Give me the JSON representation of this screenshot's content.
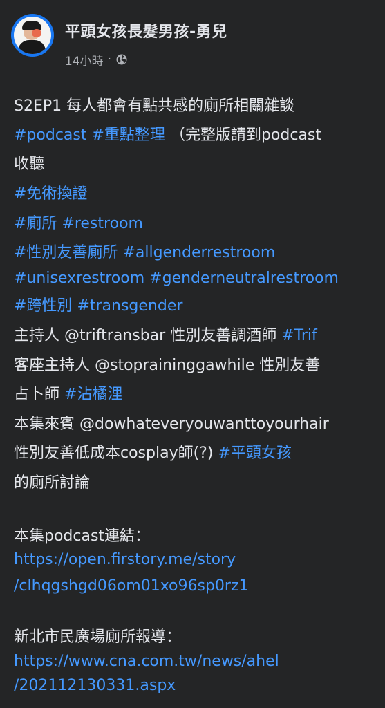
{
  "page": {
    "name": "平頭女孩長髮男孩-勇兒",
    "time": "14小時",
    "separator": "·",
    "privacy_icon": "globe-icon"
  },
  "post": {
    "l1": "S2EP1 每人都會有點共感的廁所相關雜談",
    "l2_tag1": "#podcast",
    "l2_tag2": "#重點整理",
    "l2_text": "（完整版請到podcast",
    "l3": "收聽",
    "l4_tag": "#免術換證",
    "l5_tag1": "#廁所",
    "l5_tag2": "#restroom",
    "l6_tag1": "#性別友善廁所",
    "l6_tag2": "#allgenderrestroom",
    "l7_tag1": "#unisexrestroom",
    "l7_tag2": "#genderneutralrestroom",
    "l8_tag1": "#跨性別",
    "l8_tag2": "#transgender",
    "l9_pre": "主持人 ",
    "l9_mention": "@triftransbar",
    "l9_mid": " 性別友善調酒師 ",
    "l9_tag": "#Trif",
    "l10_pre": "客座主持人 ",
    "l10_mention": "@stopraininggawhile",
    "l10_post": " 性別友善",
    "l11_pre": "占卜師 ",
    "l11_tag": "#沾橘浬",
    "l12_pre": "本集來賓 ",
    "l12_mention": "@dowhateveryouwanttoyourhair",
    "l13_pre": "性別友善低成本cosplay師(?) ",
    "l13_tag": "#平頭女孩",
    "l14": "的廁所討論",
    "l15": "本集podcast連結：",
    "l16": "https://open.firstory.me/story",
    "l17": "/clhqgshgd06om01xo96sp0rz1",
    "l18": "新北市民廣場廁所報導：",
    "l19": "https://www.cna.com.tw/news/ahel",
    "l20": "/202112130331.aspx"
  }
}
